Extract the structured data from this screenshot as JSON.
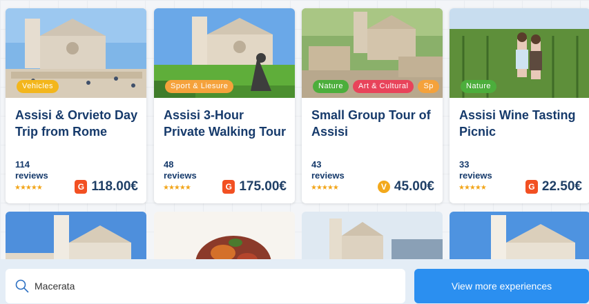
{
  "cards": [
    {
      "tags": [
        {
          "label": "Vehicles",
          "color": "#f3b61c"
        }
      ],
      "title": "Assisi & Orvieto Day Trip from Rome",
      "reviews": "114\nreviews",
      "stars": "★★★★★",
      "badge": "G",
      "badge_color": "#f25022",
      "price": "118.00€"
    },
    {
      "tags": [
        {
          "label": "Sport & Liesure",
          "color": "#f5a23b"
        }
      ],
      "title": "Assisi 3-Hour Private Walking Tour",
      "reviews": "48\nreviews",
      "stars": "★★★★★",
      "badge": "G",
      "badge_color": "#f25022",
      "price": "175.00€"
    },
    {
      "tags": [
        {
          "label": "Nature",
          "color": "#4cae3c"
        },
        {
          "label": "Art & Cultural",
          "color": "#e8435a"
        },
        {
          "label": "Sp",
          "color": "#f5a23b"
        }
      ],
      "title": "Small Group Tour of Assisi",
      "reviews": "43\nreviews",
      "stars": "★★★★★",
      "badge": "V",
      "badge_color": "#f3a91c",
      "price": "45.00€"
    },
    {
      "tags": [
        {
          "label": "Nature",
          "color": "#4cae3c"
        }
      ],
      "title": "Assisi Wine Tasting Picnic",
      "reviews": "33\nreviews",
      "stars": "★★★★★",
      "badge": "G",
      "badge_color": "#f25022",
      "price": "22.50€"
    }
  ],
  "search": {
    "value": "Macerata",
    "icon": "search-icon"
  },
  "view_more_label": "View more experiences",
  "colors": {
    "accent": "#2b8ff0",
    "title": "#163a6b",
    "star": "#f2a51a"
  }
}
